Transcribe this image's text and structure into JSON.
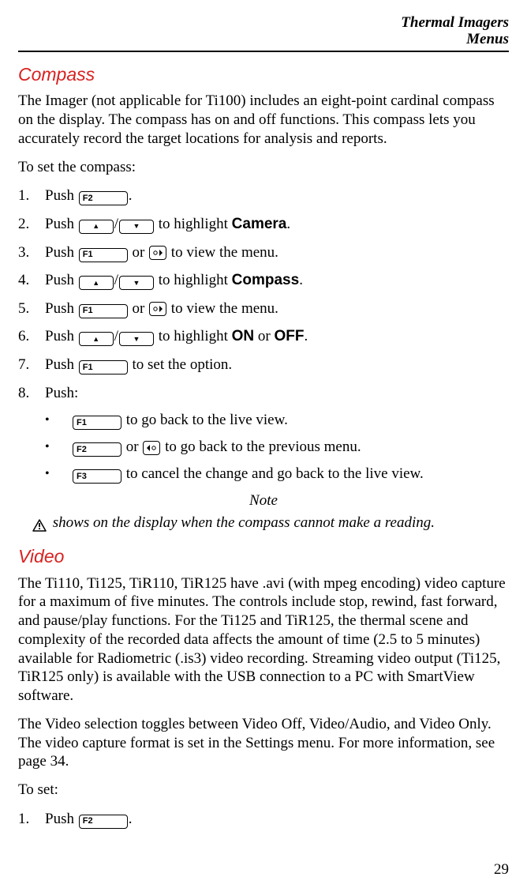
{
  "header": {
    "line1": "Thermal Imagers",
    "line2": "Menus"
  },
  "section1": {
    "title": "Compass",
    "intro": "The Imager (not applicable for Ti100) includes an eight-point cardinal compass on the display. The compass has on and off functions. This compass lets you accurately record the target locations for analysis and reports.",
    "lead": "To set the compass:",
    "steps": {
      "s1a": "Push ",
      "s1b": ".",
      "s2a": "Push ",
      "s2b": " to highlight ",
      "s2c": "Camera",
      "s2d": ".",
      "s3a": "Push ",
      "s3b": " or ",
      "s3c": " to view the menu.",
      "s4a": "Push ",
      "s4b": " to highlight ",
      "s4c": "Compass",
      "s4d": ".",
      "s5a": "Push ",
      "s5b": " or ",
      "s5c": " to view the menu.",
      "s6a": "Push ",
      "s6b": " to highlight ",
      "s6c": "ON",
      "s6d": " or ",
      "s6e": "OFF",
      "s6f": ".",
      "s7a": "Push ",
      "s7b": " to set the option.",
      "s8": "Push:"
    },
    "bullets": {
      "b1": " to go back to the live view.",
      "b2a": " or ",
      "b2b": " to go back to the previous menu.",
      "b3": " to cancel the change and go back to the live view."
    },
    "note_label": "Note",
    "note_body": " shows on the display when the compass cannot make a reading."
  },
  "section2": {
    "title": "Video",
    "p1": "The Ti110, Ti125, TiR110, TiR125 have .avi (with mpeg encoding) video capture for a maximum of five minutes. The controls include stop, rewind, fast forward, and pause/play functions. For the Ti125 and TiR125, the thermal scene and complexity of the recorded data affects the amount of time (2.5 to 5 minutes) available for Radiometric (.is3) video recording. Streaming video output (Ti125, TiR125 only) is available with the USB connection to a PC with SmartView software.",
    "p2": "The Video selection toggles between Video Off, Video/Audio, and Video Only. The video capture format is set in the Settings menu. For more information, see page 34.",
    "lead": "To set:",
    "s1a": "Push ",
    "s1b": "."
  },
  "keys": {
    "F1": "F1",
    "F2": "F2",
    "F3": "F3"
  },
  "nums": {
    "n1": "1.",
    "n2": "2.",
    "n3": "3.",
    "n4": "4.",
    "n5": "5.",
    "n6": "6.",
    "n7": "7.",
    "n8": "8."
  },
  "bullet_char": "•",
  "slash": "/",
  "page_number": "29"
}
